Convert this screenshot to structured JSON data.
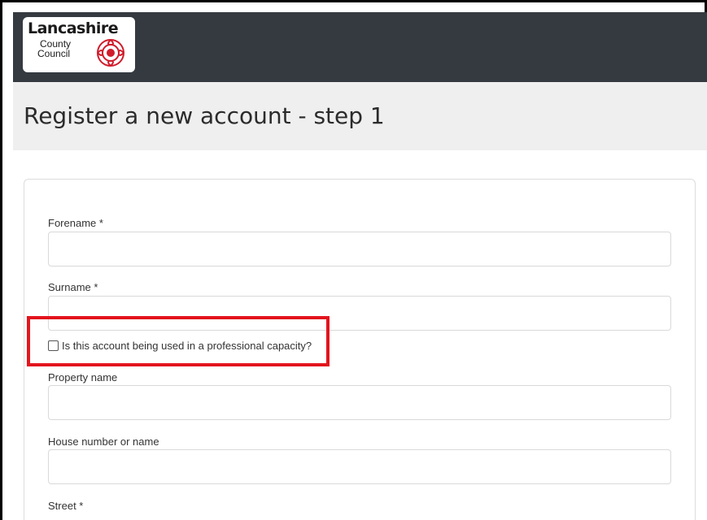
{
  "header": {
    "logo": {
      "title": "Lancashire",
      "line1": "County",
      "line2": "Council"
    }
  },
  "page": {
    "title": "Register a new account - step 1"
  },
  "form": {
    "forename_label": "Forename *",
    "forename_value": "",
    "surname_label": "Surname *",
    "surname_value": "",
    "professional_checkbox_label": "Is this account being used in a professional capacity?",
    "professional_checked": false,
    "property_name_label": "Property name",
    "property_name_value": "",
    "house_number_label": "House number or name",
    "house_number_value": "",
    "street_label": "Street *"
  },
  "colors": {
    "navbar": "#343a40",
    "title_bar": "#efefef",
    "highlight": "#e3141d",
    "rose": "#d01c2b"
  }
}
